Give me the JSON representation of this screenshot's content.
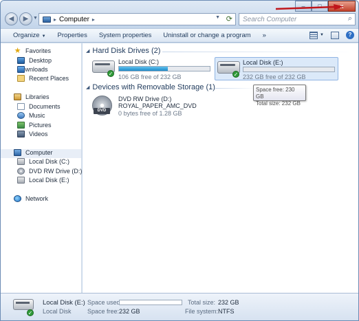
{
  "address": {
    "crumb": "Computer"
  },
  "search": {
    "placeholder": "Search Computer"
  },
  "window": {
    "min": "–",
    "max": "□",
    "close": "x"
  },
  "toolbar": {
    "organize": "Organize",
    "properties": "Properties",
    "system_properties": "System properties",
    "uninstall": "Uninstall or change a program",
    "more": "»"
  },
  "nav": {
    "favorites": "Favorites",
    "desktop": "Desktop",
    "downloads": "Downloads",
    "recent": "Recent Places",
    "libraries": "Libraries",
    "documents": "Documents",
    "music": "Music",
    "pictures": "Pictures",
    "videos": "Videos",
    "computer": "Computer",
    "local_c": "Local Disk (C:)",
    "dvd": "DVD RW Drive (D:) R",
    "local_e": "Local Disk (E:)",
    "network": "Network"
  },
  "groups": {
    "hdd": "Hard Disk Drives (2)",
    "removable": "Devices with Removable Storage (1)"
  },
  "drives": [
    {
      "name": "Local Disk (C:)",
      "free": "106 GB free of 232 GB",
      "used_fraction": 0.54
    },
    {
      "name": "Local Disk (E:)",
      "free": "232 GB free of 232 GB",
      "used_fraction": 0.0
    }
  ],
  "dvd": {
    "name": "DVD RW Drive (D:)",
    "label": "ROYAL_PAPER_AMC_DVD",
    "free": "0 bytes free of 1.28 GB",
    "badge": "DVD"
  },
  "tooltip": {
    "line1": "Space free: 230 GB",
    "line2": "Total size: 232 GB"
  },
  "details": {
    "name": "Local Disk (E:)",
    "type": "Local Disk",
    "space_used_label": "Space used:",
    "space_free_label": "Space free:",
    "space_free_value": "232 GB",
    "total_size_label": "Total size:",
    "total_size_value": "232 GB",
    "fs_label": "File system:",
    "fs_value": "NTFS"
  },
  "colors": {
    "accent": "#1f8bc9",
    "arrow": "#c0161b",
    "ok": "#2f9a38"
  }
}
